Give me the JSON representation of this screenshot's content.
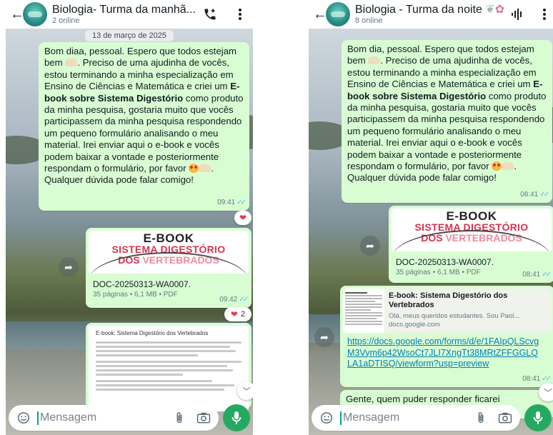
{
  "chat1": {
    "title": "Biologia- Turma da manhã...",
    "subtitle": "2 online",
    "header_icons": [
      "back-arrow-icon",
      "add-call-icon",
      "more-vert-icon"
    ],
    "date_chip": "13 de março de 2025",
    "message": {
      "p1": "Bom diaa, pessoal. Espero que todos estejam bem ",
      "p2": ". Preciso de uma ajudinha de vocês, estou terminando a minha especialização em Ensino de Ciências e Matemática e criei um ",
      "bold": "E-book sobre Sistema Digestório",
      "p3": " como produto da minha pesquisa, gostaria muito que vocês participassem da minha pesquisa respondendo um pequeno formulário analisando o meu material. Irei enviar aqui o e-book e vocês podem baixar a vontade e posteriormente respondam o formulário, por favor ",
      "p4": ". Qualquer dúvida pode falar comigo!",
      "time": "09:41",
      "reaction": "❤"
    },
    "document": {
      "cover_line1": "E-BOOK",
      "cover_line2": "SISTEMA DIGESTÓRIO",
      "cover_line3a": "DOS",
      "cover_line3b": "VERTEBRADOS",
      "filename": "DOC-20250313-WA0007.",
      "meta": "35 páginas • 6,1 MB • PDF",
      "time": "09:42",
      "reaction": "❤",
      "reaction_count": "2"
    },
    "preview": {
      "title": "E-book: Sistema Digestório dos Vertebrados"
    },
    "composer": {
      "placeholder": "Mensagem"
    }
  },
  "chat2": {
    "title": "Biologia - Turma da noite",
    "subtitle": "8 online",
    "header_icons": [
      "back-arrow-icon",
      "voice-chat-icon",
      "more-vert-icon"
    ],
    "message": {
      "p1": "Bom dia, pessoal. Espero que todos estejam bem ",
      "p2": ". Preciso de uma ajudinha de vocês, estou terminando a minha especialização em Ensino de Ciências e Matemática e criei um ",
      "bold": "E-book sobre Sistema Digestório",
      "p3": " como produto da minha pesquisa, gostaria muito que vocês participassem da minha pesquisa respondendo um pequeno formulário analisando o meu material. Irei enviar aqui o e-book e vocês podem baixar a vontade e posteriormente respondam o formulário, por favor ",
      "p4": ". Qualquer dúvida pode falar comigo!",
      "time": "08:41"
    },
    "document": {
      "cover_line1": "E-BOOK",
      "cover_line2": "SISTEMA DIGESTÓRIO",
      "cover_line3a": "DOS",
      "cover_line3b": "VERTEBRADOS",
      "filename": "DOC-20250313-WA0007.",
      "meta": "35 páginas • 6,1 MB • PDF",
      "time": "08:41"
    },
    "link": {
      "title": "E-book: Sistema Digestório dos Vertebrados",
      "description": "Olá, meus queridos estudantes. Sou Paol... docs.google.com",
      "url": "https://docs.google.com/forms/d/e/1FAIpQLScvgM3Vym6p42WsoCt7JLI7XngTt38MRtZFFGGLQLA1aDTISQ/viewform?usp=preview",
      "time": "08:41"
    },
    "next_message": "Gente, quem puder responder ficarei agradecida, é bem rapidinho o formulário",
    "composer": {
      "placeholder": "Mensagem"
    }
  },
  "colors": {
    "bubble_out": "#d9fdd3",
    "accent_green": "#25a960",
    "link_blue": "#027eb5",
    "read_ticks": "#53bdeb",
    "ebook_red": "#d6334f"
  }
}
